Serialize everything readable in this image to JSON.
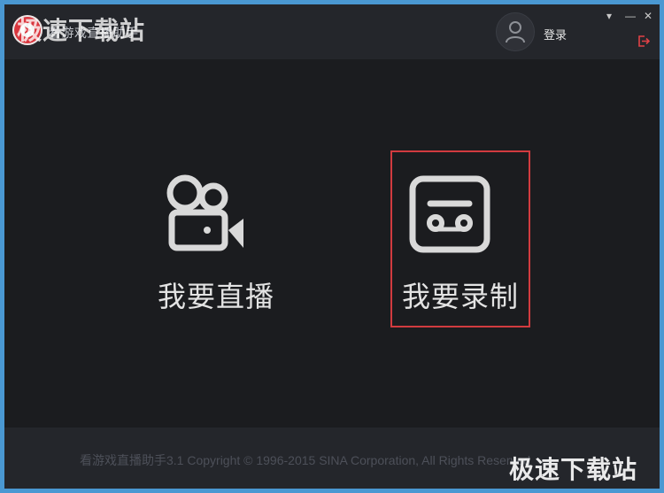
{
  "app": {
    "title": "看游戏直播助手",
    "watermark": "极速下载站"
  },
  "header": {
    "login_label": "登录",
    "menu_glyph": "▾",
    "minimize_glyph": "—",
    "close_glyph": "✕",
    "avatar_icon": "user-icon",
    "logout_icon": "logout-icon"
  },
  "main": {
    "options": [
      {
        "label": "我要直播",
        "icon": "video-camera-icon",
        "selected": false
      },
      {
        "label": "我要录制",
        "icon": "recorder-icon",
        "selected": true
      }
    ]
  },
  "footer": {
    "copyright": "看游戏直播助手3.1 Copyright © 1996-2015 SINA Corporation, All Rights Reserved",
    "watermark": "极速下载站"
  },
  "colors": {
    "window_bg": "#1b1c1f",
    "bar_bg": "#24262b",
    "highlight_border": "#d23b3f",
    "logo_red": "#d9363e"
  }
}
